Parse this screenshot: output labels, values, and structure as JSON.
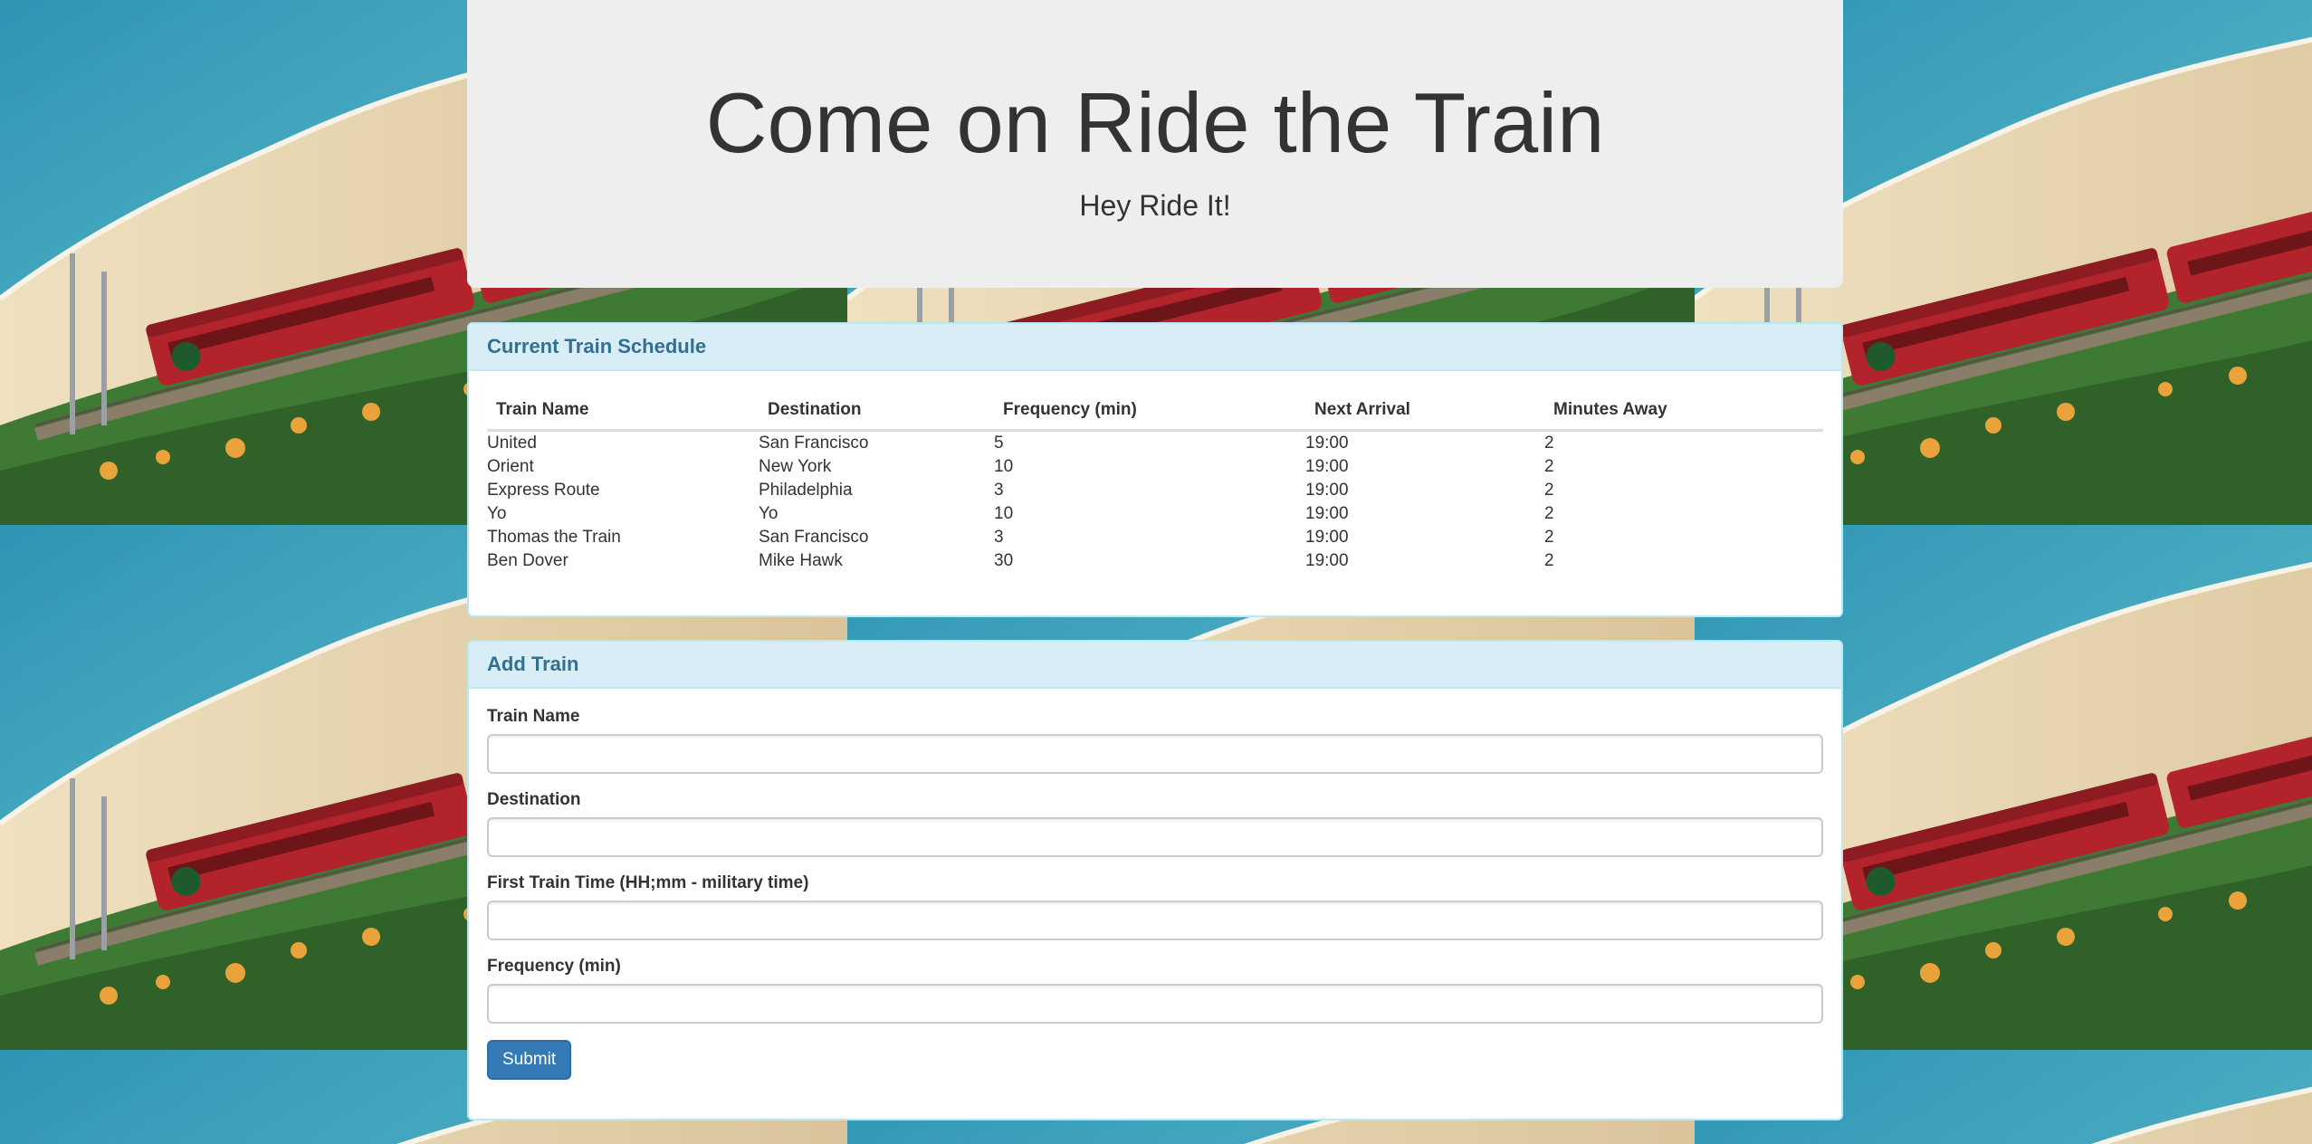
{
  "header": {
    "title": "Come on Ride the Train",
    "subtitle": "Hey Ride It!"
  },
  "schedule": {
    "title": "Current Train Schedule",
    "columns": [
      "Train Name",
      "Destination",
      "Frequency (min)",
      "Next Arrival",
      "Minutes Away"
    ],
    "rows": [
      [
        "United",
        "San Francisco",
        "5",
        "19:00",
        "2"
      ],
      [
        "Orient",
        "New York",
        "10",
        "19:00",
        "2"
      ],
      [
        "Express Route",
        "Philadelphia",
        "3",
        "19:00",
        "2"
      ],
      [
        "Yo",
        "Yo",
        "10",
        "19:00",
        "2"
      ],
      [
        "Thomas the Train",
        "San Francisco",
        "3",
        "19:00",
        "2"
      ],
      [
        "Ben Dover",
        "Mike Hawk",
        "30",
        "19:00",
        "2"
      ]
    ]
  },
  "add_train": {
    "title": "Add Train",
    "fields": [
      {
        "label": "Train Name",
        "value": ""
      },
      {
        "label": "Destination",
        "value": ""
      },
      {
        "label": "First Train Time (HH;mm - military time)",
        "value": ""
      },
      {
        "label": "Frequency (min)",
        "value": ""
      }
    ],
    "submit_label": "Submit"
  },
  "colors": {
    "jumbotron_bg": "#eeeeee",
    "panel_heading_bg": "#d9edf7",
    "panel_heading_text": "#31708f",
    "primary_button": "#337ab7"
  },
  "background": {
    "icon": "train-beach-photo"
  }
}
